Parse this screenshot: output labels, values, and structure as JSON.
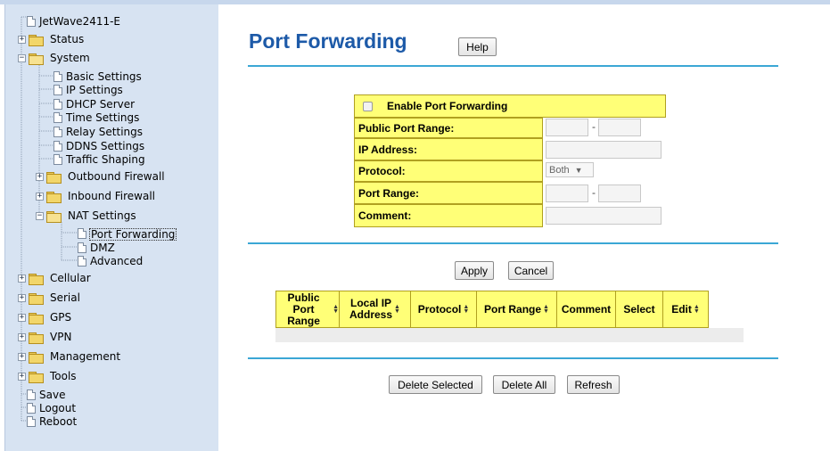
{
  "sidebar": {
    "root": "JetWave2411-E",
    "items": [
      {
        "label": "Status",
        "type": "folder",
        "state": "collapsed"
      },
      {
        "label": "System",
        "type": "folder",
        "state": "expanded"
      },
      {
        "label": "Basic Settings",
        "type": "page"
      },
      {
        "label": "IP Settings",
        "type": "page"
      },
      {
        "label": "DHCP Server",
        "type": "page"
      },
      {
        "label": "Time Settings",
        "type": "page"
      },
      {
        "label": "Relay Settings",
        "type": "page"
      },
      {
        "label": "DDNS Settings",
        "type": "page"
      },
      {
        "label": "Traffic Shaping",
        "type": "page"
      },
      {
        "label": "Outbound Firewall",
        "type": "folder",
        "state": "collapsed"
      },
      {
        "label": "Inbound Firewall",
        "type": "folder",
        "state": "collapsed"
      },
      {
        "label": "NAT Settings",
        "type": "folder",
        "state": "expanded"
      },
      {
        "label": "Port Forwarding",
        "type": "page",
        "selected": true
      },
      {
        "label": "DMZ",
        "type": "page"
      },
      {
        "label": "Advanced",
        "type": "page"
      },
      {
        "label": "Cellular",
        "type": "folder",
        "state": "collapsed"
      },
      {
        "label": "Serial",
        "type": "folder",
        "state": "collapsed"
      },
      {
        "label": "GPS",
        "type": "folder",
        "state": "collapsed"
      },
      {
        "label": "VPN",
        "type": "folder",
        "state": "collapsed"
      },
      {
        "label": "Management",
        "type": "folder",
        "state": "collapsed"
      },
      {
        "label": "Tools",
        "type": "folder",
        "state": "collapsed"
      },
      {
        "label": "Save",
        "type": "page"
      },
      {
        "label": "Logout",
        "type": "page"
      },
      {
        "label": "Reboot",
        "type": "page"
      }
    ],
    "expand_symbol_collapsed": "+",
    "expand_symbol_expanded": "−"
  },
  "page": {
    "title": "Port Forwarding",
    "help_label": "Help"
  },
  "form": {
    "enable_label": "Enable Port Forwarding",
    "enable_checked": false,
    "public_port_range_label": "Public Port Range:",
    "ip_address_label": "IP Address:",
    "protocol_label": "Protocol:",
    "protocol_value": "Both",
    "protocol_arrow": "▼",
    "port_range_label": "Port Range:",
    "comment_label": "Comment:",
    "range_separator": "-"
  },
  "actions": {
    "apply_label": "Apply",
    "cancel_label": "Cancel"
  },
  "table": {
    "columns": [
      {
        "line1": "Public Port",
        "line2": "Range",
        "sortable": true
      },
      {
        "line1": "Local IP",
        "line2": "Address",
        "sortable": true
      },
      {
        "line1": "Protocol",
        "line2": "",
        "sortable": true
      },
      {
        "line1": "Port Range",
        "line2": "",
        "sortable": true
      },
      {
        "line1": "Comment",
        "line2": "",
        "sortable": false
      },
      {
        "line1": "Select",
        "line2": "",
        "sortable": false
      },
      {
        "line1": "Edit",
        "line2": "",
        "sortable": true
      }
    ],
    "rows": []
  },
  "bottom_actions": {
    "delete_selected_label": "Delete Selected",
    "delete_all_label": "Delete All",
    "refresh_label": "Refresh"
  },
  "colors": {
    "title": "#1d5aa8",
    "rule": "#3ba7d5",
    "cell_yellow": "#ffff77",
    "sidebar_bg": "#d7e3f2"
  }
}
